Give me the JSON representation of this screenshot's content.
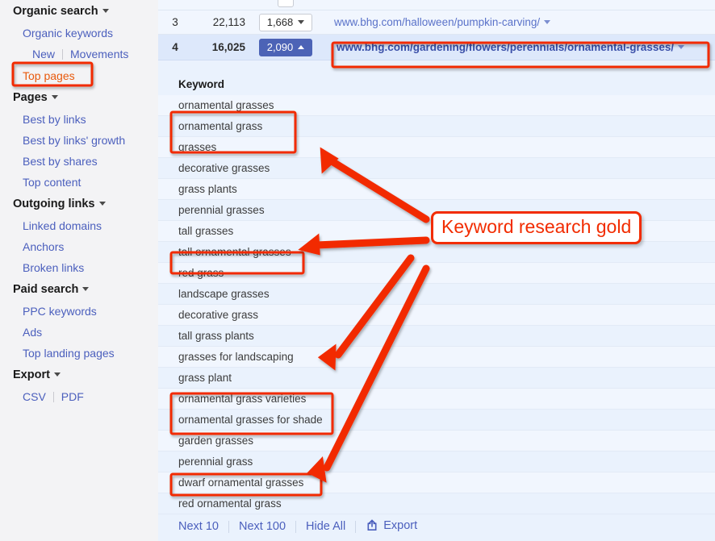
{
  "sidebar": {
    "groups": [
      {
        "label": "Organic search",
        "items": [
          {
            "label": "Organic keywords"
          }
        ],
        "subrow": {
          "left": "New",
          "right": "Movements"
        },
        "active_item": {
          "label": "Top pages"
        }
      },
      {
        "label": "Pages",
        "items": [
          {
            "label": "Best by links"
          },
          {
            "label": "Best by links' growth"
          },
          {
            "label": "Best by shares"
          },
          {
            "label": "Top content"
          }
        ]
      },
      {
        "label": "Outgoing links",
        "items": [
          {
            "label": "Linked domains"
          },
          {
            "label": "Anchors"
          },
          {
            "label": "Broken links"
          }
        ]
      },
      {
        "label": "Paid search",
        "items": [
          {
            "label": "PPC keywords"
          },
          {
            "label": "Ads"
          },
          {
            "label": "Top landing pages"
          }
        ]
      },
      {
        "label": "Export",
        "export_row": {
          "left": "CSV",
          "right": "PDF"
        }
      }
    ]
  },
  "pages_table": {
    "rows": [
      {
        "rank": "3",
        "traffic": "22,113",
        "keywords": "1,668",
        "keywords_caret": "chevron-down",
        "url": "www.bhg.com/halloween/pumpkin-carving/",
        "selected": false
      },
      {
        "rank": "4",
        "traffic": "16,025",
        "keywords": "2,090",
        "keywords_caret": "chevron-up",
        "url": "www.bhg.com/gardening/flowers/perennials/ornamental-grasses/",
        "selected": true
      }
    ]
  },
  "keyword_table": {
    "header": "Keyword",
    "rows": [
      {
        "keyword": "ornamental grasses"
      },
      {
        "keyword": "ornamental grass"
      },
      {
        "keyword": "grasses"
      },
      {
        "keyword": "decorative grasses"
      },
      {
        "keyword": "grass plants"
      },
      {
        "keyword": "perennial grasses"
      },
      {
        "keyword": "tall grasses"
      },
      {
        "keyword": "tall ornamental grasses"
      },
      {
        "keyword": "red grass"
      },
      {
        "keyword": "landscape grasses"
      },
      {
        "keyword": "decorative grass"
      },
      {
        "keyword": "tall grass plants"
      },
      {
        "keyword": "grasses for landscaping"
      },
      {
        "keyword": "grass plant"
      },
      {
        "keyword": "ornamental grass varieties"
      },
      {
        "keyword": "ornamental grasses for shade"
      },
      {
        "keyword": "garden grasses"
      },
      {
        "keyword": "perennial grass"
      },
      {
        "keyword": "dwarf ornamental grasses"
      },
      {
        "keyword": "red ornamental grass"
      }
    ]
  },
  "footer": {
    "next_10": "Next 10",
    "next_100": "Next 100",
    "hide_all": "Hide All",
    "export": "Export"
  },
  "annotations": {
    "label": "Keyword research gold",
    "accent_color": "#f22c00",
    "active_item_color": "#e8590c"
  }
}
